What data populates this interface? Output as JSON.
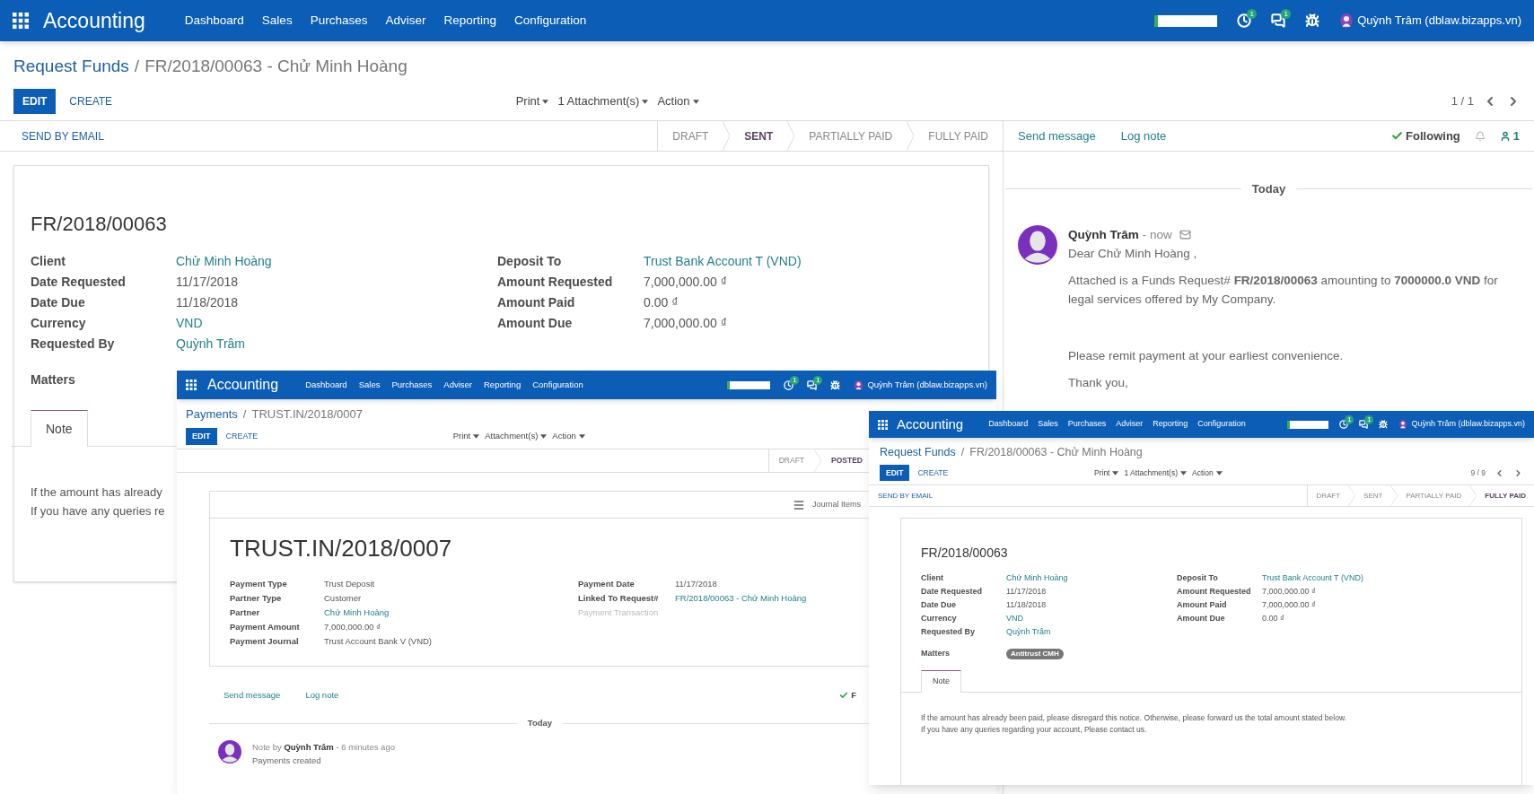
{
  "windows": [
    {
      "navbar": {
        "app": "Accounting",
        "menu": [
          "Dashboard",
          "Sales",
          "Purchases",
          "Adviser",
          "Reporting",
          "Configuration"
        ],
        "progress": {
          "level": 0.06
        },
        "activity_badge": "1",
        "message_badge": "1",
        "user": "Quỳnh Trâm (dblaw.bizapps.vn)"
      },
      "breadcrumb": {
        "parent": "Request Funds",
        "separator": "/",
        "current": "FR/2018/00063 - Chử Minh Hoàng"
      },
      "buttons": {
        "edit": "EDIT",
        "create": "CREATE"
      },
      "dropdowns": [
        "Print",
        "1 Attachment(s)",
        "Action"
      ],
      "pager": "1 / 1",
      "header_buttons": [
        "SEND BY EMAIL"
      ],
      "steps": [
        {
          "label": "DRAFT",
          "selected": false
        },
        {
          "label": "SENT",
          "selected": true
        },
        {
          "label": "PARTIALLY PAID",
          "selected": false
        },
        {
          "label": "FULLY PAID",
          "selected": false
        }
      ],
      "title": "FR/2018/00063",
      "left_fields": [
        {
          "label": "Client",
          "value": "Chử Minh Hoàng",
          "link": true
        },
        {
          "label": "Date Requested",
          "value": "11/17/2018",
          "link": false
        },
        {
          "label": "Date Due",
          "value": "11/18/2018",
          "link": false
        },
        {
          "label": "Currency",
          "value": "VND",
          "link": true
        },
        {
          "label": "Requested By",
          "value": "Quỳnh Trâm",
          "link": true
        }
      ],
      "right_fields": [
        {
          "label": "Deposit To",
          "value": "Trust Bank Account T (VND)",
          "link": true
        },
        {
          "label": "Amount Requested",
          "value": "7,000,000.00 ₫",
          "link": false
        },
        {
          "label": "Amount Paid",
          "value": "0.00 ₫",
          "link": false
        },
        {
          "label": "Amount Due",
          "value": "7,000,000.00 ₫",
          "link": false
        }
      ],
      "matters": {
        "label": "Matters"
      },
      "tabs": [
        {
          "label": "Note",
          "selected": true
        }
      ],
      "note": [
        "If the amount has already",
        "If you have any queries re"
      ],
      "chatter": {
        "send": "Send message",
        "log": "Log note",
        "following": "Following",
        "followers": "1",
        "separator": "Today",
        "messages": [
          {
            "kind": "email",
            "author": "Quỳnh Trâm",
            "time": "- now",
            "body": [
              "Dear Chử Minh Hoàng ,",
              "Attached is a Funds Request# **FR/2018/00063** amounting to **7000000.0 VND** for legal services offered by My Company.",
              "Please remit payment at your earliest convenience.",
              "Thank you,"
            ]
          }
        ]
      }
    },
    {
      "navbar": {
        "app": "Accounting",
        "menu": [
          "Dashboard",
          "Sales",
          "Purchases",
          "Adviser",
          "Reporting",
          "Configuration"
        ],
        "progress": {
          "level": 0.06
        },
        "activity_badge": "1",
        "message_badge": "1",
        "user": "Quỳnh Trâm (dblaw.bizapps.vn)"
      },
      "breadcrumb": {
        "parent": "Payments",
        "separator": "/",
        "current": "TRUST.IN/2018/0007"
      },
      "buttons": {
        "edit": "EDIT",
        "create": "CREATE"
      },
      "dropdowns": [
        "Print",
        "Attachment(s)",
        "Action"
      ],
      "steps": [
        {
          "label": "DRAFT",
          "selected": false
        },
        {
          "label": "POSTED",
          "selected": true
        }
      ],
      "sheet_buttons": [
        "Journal Items"
      ],
      "title": "TRUST.IN/2018/0007",
      "left_fields": [
        {
          "label": "Payment Type",
          "value": "Trust Deposit",
          "link": false
        },
        {
          "label": "Partner Type",
          "value": "Customer",
          "link": false
        },
        {
          "label": "Partner",
          "value": "Chử Minh Hoàng",
          "link": true
        },
        {
          "label": "Payment Amount",
          "value": "7,000,000.00 ₫",
          "link": false
        },
        {
          "label": "Payment Journal",
          "value": "Trust Account Bank V (VND)",
          "link": false
        }
      ],
      "right_fields": [
        {
          "label": "Payment Date",
          "value": "11/17/2018",
          "link": false,
          "muted": false
        },
        {
          "label": "Linked To Request#",
          "value": "FR/2018/00063 - Chử Minh Hoàng",
          "link": true,
          "muted": false
        },
        {
          "label": "Payment Transaction",
          "muted": true
        }
      ],
      "chatter": {
        "send": "Send message",
        "log": "Log note",
        "following": "F",
        "separator": "Today",
        "messages": [
          {
            "kind": "note",
            "header": "Note by **Quỳnh Trâm** - 6 minutes ago",
            "body": [
              "Payments created"
            ]
          }
        ]
      }
    },
    {
      "navbar": {
        "app": "Accounting",
        "menu": [
          "Dashboard",
          "Sales",
          "Purchases",
          "Adviser",
          "Reporting",
          "Configuration"
        ],
        "progress": {
          "level": 0.06
        },
        "activity_badge": "1",
        "message_badge": "1",
        "user": "Quỳnh Trâm (dblaw.bizapps.vn)"
      },
      "breadcrumb": {
        "parent": "Request Funds",
        "separator": "/",
        "current": "FR/2018/00063 - Chử Minh Hoàng"
      },
      "buttons": {
        "edit": "EDIT",
        "create": "CREATE"
      },
      "dropdowns": [
        "Print",
        "1 Attachment(s)",
        "Action"
      ],
      "pager": "9 / 9",
      "header_buttons": [
        "SEND BY EMAIL"
      ],
      "steps": [
        {
          "label": "DRAFT",
          "selected": false
        },
        {
          "label": "SENT",
          "selected": false
        },
        {
          "label": "PARTIALLY PAID",
          "selected": false
        },
        {
          "label": "FULLY PAID",
          "selected": true
        }
      ],
      "title": "FR/2018/00063",
      "left_fields": [
        {
          "label": "Client",
          "value": "Chử Minh Hoàng",
          "link": true
        },
        {
          "label": "Date Requested",
          "value": "11/17/2018",
          "link": false
        },
        {
          "label": "Date Due",
          "value": "11/18/2018",
          "link": false
        },
        {
          "label": "Currency",
          "value": "VND",
          "link": true
        },
        {
          "label": "Requested By",
          "value": "Quỳnh Trâm",
          "link": true
        }
      ],
      "right_fields": [
        {
          "label": "Deposit To",
          "value": "Trust Bank Account T (VND)",
          "link": true
        },
        {
          "label": "Amount Requested",
          "value": "7,000,000.00 ₫",
          "link": false
        },
        {
          "label": "Amount Paid",
          "value": "7,000,000.00 ₫",
          "link": false
        },
        {
          "label": "Amount Due",
          "value": "0.00 ₫",
          "link": false
        }
      ],
      "matters": {
        "label": "Matters",
        "tags": [
          "Antitrust CMH"
        ]
      },
      "tabs": [
        {
          "label": "Note",
          "selected": true
        }
      ],
      "note": [
        "If the amount has already been paid, please disregard this notice. Otherwise, please forward us the total amount stated below.",
        "If you have any queries regarding your account, Please contact us."
      ]
    }
  ]
}
